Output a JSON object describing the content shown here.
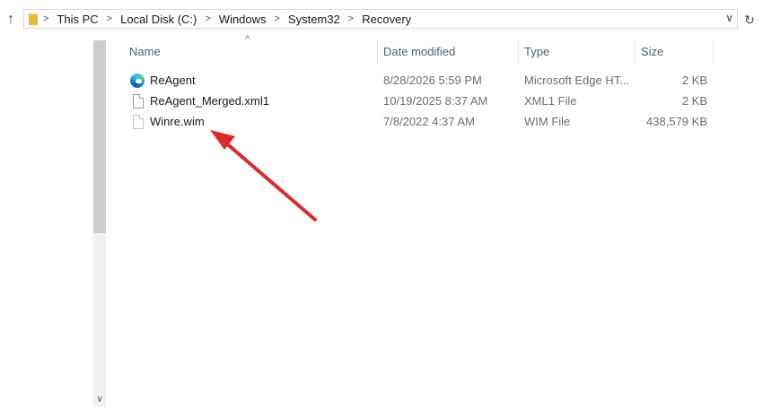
{
  "address_bar": {
    "breadcrumbs": [
      "This PC",
      "Local Disk (C:)",
      "Windows",
      "System32",
      "Recovery"
    ],
    "separator": ">",
    "dropdown_glyph": "∨"
  },
  "nav": {
    "up_glyph": "↑",
    "refresh_glyph": "↻"
  },
  "columns": {
    "name": "Name",
    "date_modified": "Date modified",
    "type": "Type",
    "size": "Size",
    "sorted_by": "name"
  },
  "files": [
    {
      "name": "ReAgent",
      "date_modified": "8/28/2026 5:59 PM",
      "type": "Microsoft Edge HT...",
      "size": "2 KB",
      "icon": "edge-icon"
    },
    {
      "name": "ReAgent_Merged.xml1",
      "date_modified": "10/19/2025 8:37 AM",
      "type": "XML1 File",
      "size": "2 KB",
      "icon": "file-icon"
    },
    {
      "name": "Winre.wim",
      "date_modified": "7/8/2022 4:37 AM",
      "type": "WIM File",
      "size": "438,579 KB",
      "icon": "file-icon"
    }
  ],
  "annotation": {
    "color": "#d92b2b",
    "points_to": "Winre.wim"
  },
  "colors": {
    "header_text": "#4c607a",
    "muted_text": "#6d6d6d",
    "scroll_thumb": "#cdcdcd"
  }
}
